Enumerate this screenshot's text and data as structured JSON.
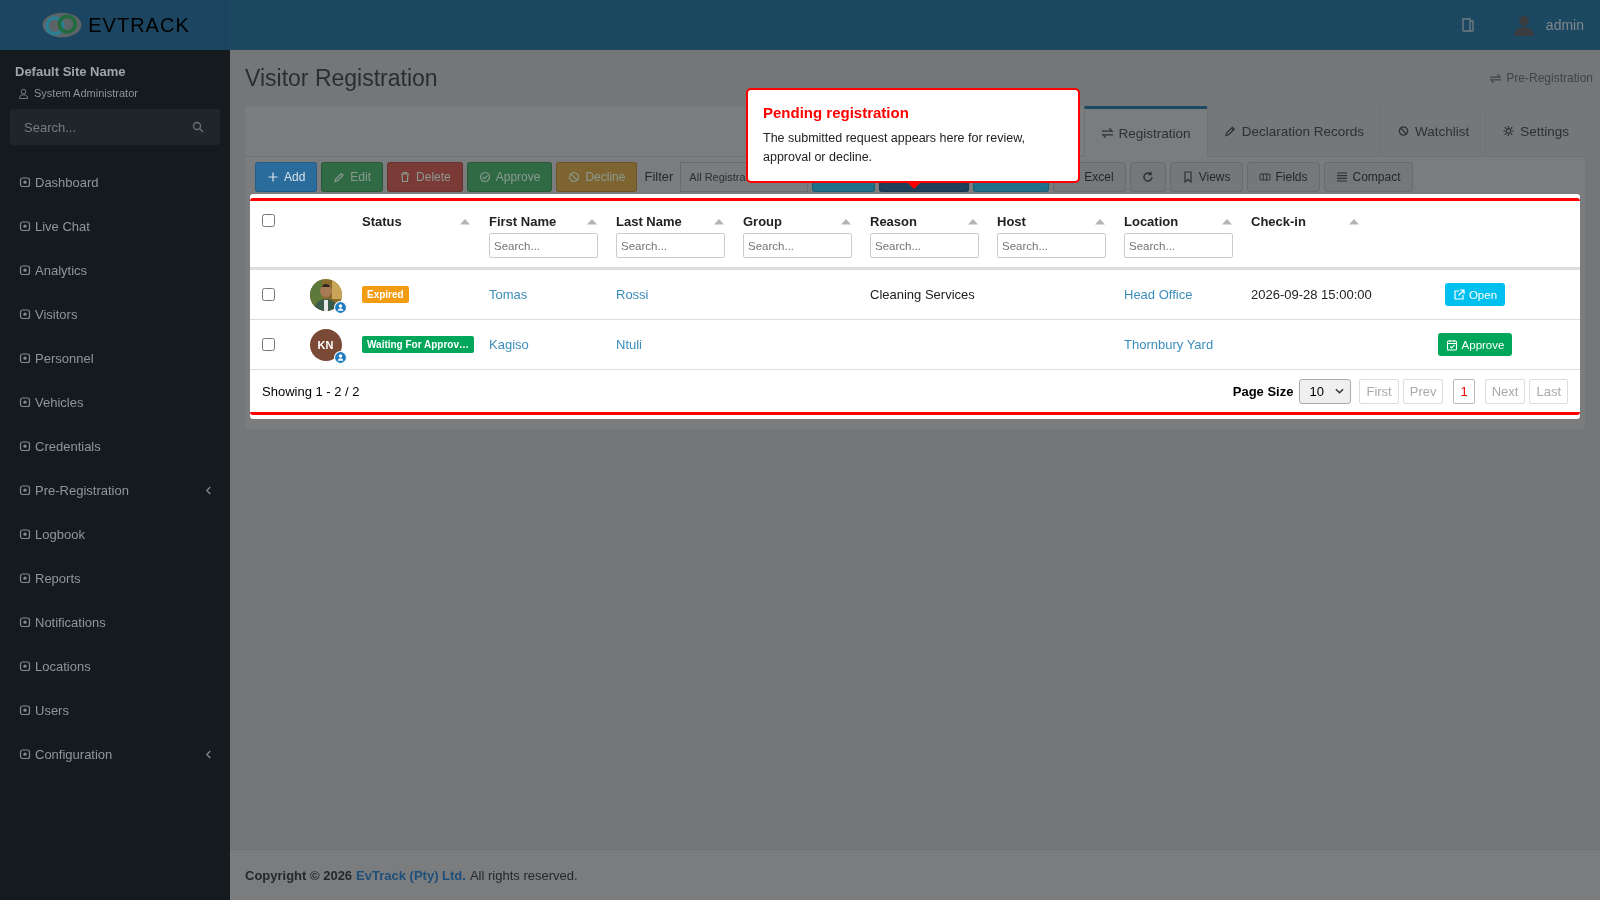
{
  "header": {
    "logo": "**EV**TRACK",
    "user": "admin"
  },
  "sidebar": {
    "site_name": "Default Site Name",
    "role": "System Administrator",
    "search": {
      "placeholder": "Search..."
    },
    "items": [
      {
        "label": "Dashboard",
        "has_submenu": false
      },
      {
        "label": "Live Chat",
        "has_submenu": false
      },
      {
        "label": "Analytics",
        "has_submenu": false
      },
      {
        "label": "Visitors",
        "has_submenu": false
      },
      {
        "label": "Personnel",
        "has_submenu": false
      },
      {
        "label": "Vehicles",
        "has_submenu": false
      },
      {
        "label": "Credentials",
        "has_submenu": false
      },
      {
        "label": "Pre-Registration",
        "has_submenu": true
      },
      {
        "label": "Logbook",
        "has_submenu": false
      },
      {
        "label": "Reports",
        "has_submenu": false
      },
      {
        "label": "Notifications",
        "has_submenu": false
      },
      {
        "label": "Locations",
        "has_submenu": false
      },
      {
        "label": "Users",
        "has_submenu": false
      },
      {
        "label": "Configuration",
        "has_submenu": true
      }
    ]
  },
  "page": {
    "title": "Visitor Registration",
    "breadcrumb": "Pre-Registration"
  },
  "tabs": [
    {
      "label": "Registration",
      "selected": true
    },
    {
      "label": "Declaration Records",
      "selected": false
    },
    {
      "label": "Watchlist",
      "selected": false
    },
    {
      "label": "Settings",
      "selected": false
    }
  ],
  "toolbar": {
    "actions": [
      {
        "label": "Add",
        "kind": "add",
        "disabled": false
      },
      {
        "label": "Edit",
        "kind": "edit",
        "disabled": true
      },
      {
        "label": "Delete",
        "kind": "delete",
        "disabled": true
      },
      {
        "label": "Approve",
        "kind": "approve",
        "disabled": true
      },
      {
        "label": "Decline",
        "kind": "decline",
        "disabled": true
      }
    ],
    "filter_label": "Filter",
    "filter_value": "All Registra",
    "tools": [
      {
        "label": "Excel",
        "kind": "excel"
      },
      {
        "kind": "refresh"
      },
      {
        "label": "Views",
        "kind": "views"
      },
      {
        "label": "Fields",
        "kind": "fields"
      },
      {
        "label": "Compact",
        "kind": "compact"
      }
    ]
  },
  "table": {
    "select_all_checked": false,
    "columns": [
      {
        "label": "Status"
      },
      {
        "label": "First Name",
        "filter_placeholder": "Search..."
      },
      {
        "label": "Last Name",
        "filter_placeholder": "Search..."
      },
      {
        "label": "Group",
        "filter_placeholder": "Search..."
      },
      {
        "label": "Reason",
        "filter_placeholder": "Search..."
      },
      {
        "label": "Host",
        "filter_placeholder": "Search..."
      },
      {
        "label": "Location",
        "filter_placeholder": "Search..."
      },
      {
        "label": "Check-in"
      }
    ],
    "rows": [
      {
        "checked": false,
        "status": {
          "label": "Expired",
          "color": "#f39c12"
        },
        "first_name": "Tomas",
        "last_name": "Rossi",
        "group": null,
        "reason": "Cleaning Services",
        "host": null,
        "location": "Head Office",
        "checkin": "2026-09-28 15:00:00",
        "action": {
          "label": "Open",
          "kind": "open"
        }
      },
      {
        "checked": false,
        "avatar": {
          "kind": "initials",
          "initials": "KN"
        },
        "status": {
          "label": "Waiting For Approv…",
          "color": "#00a65a"
        },
        "first_name": "Kagiso",
        "last_name": "Ntuli",
        "group": null,
        "reason": null,
        "host": null,
        "location": "Thornbury Yard",
        "checkin": null,
        "action": {
          "label": "Approve",
          "kind": "approve"
        }
      }
    ],
    "showing": "Showing 1 - 2 / 2",
    "page_size_label": "Page Size",
    "page_size": "10",
    "pager": [
      {
        "label": "First",
        "selected": false
      },
      {
        "label": "Prev",
        "selected": false
      },
      {
        "label": "1",
        "selected": true
      },
      {
        "label": "Next",
        "selected": false
      },
      {
        "label": "Last",
        "selected": false
      }
    ]
  },
  "popover": {
    "title": "Pending registration",
    "body": "The submitted request appears here for review, approval or decline."
  },
  "footer": {
    "prefix": "Copyright © 2026",
    "company": "EvTrack (Pty) Ltd.",
    "suffix": "All rights reserved."
  }
}
